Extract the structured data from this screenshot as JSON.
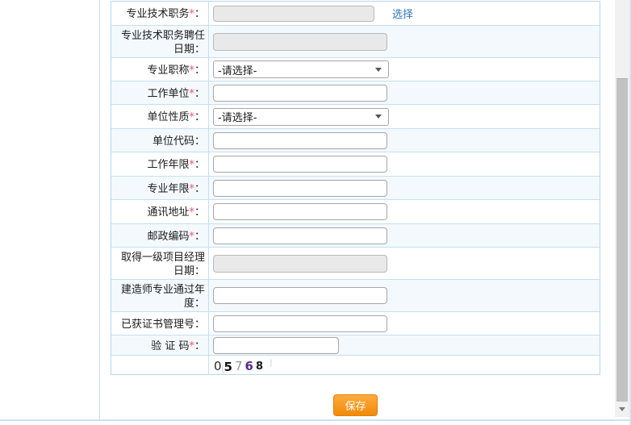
{
  "form": {
    "rows": [
      {
        "label": "专业技术职务",
        "star": "*",
        "colon": "：",
        "type": "readonly",
        "link": "选择"
      },
      {
        "label": "专业技术职务聘任日期",
        "star": "",
        "colon": "：",
        "type": "readonly"
      },
      {
        "label": "专业职称",
        "star": "*",
        "colon": "：",
        "type": "select",
        "value": "-请选择-"
      },
      {
        "label": "工作单位",
        "star": "*",
        "colon": "：",
        "type": "text",
        "value": ""
      },
      {
        "label": "单位性质",
        "star": "*",
        "colon": "：",
        "type": "select",
        "value": "-请选择-"
      },
      {
        "label": "单位代码",
        "star": "",
        "colon": "：",
        "type": "text",
        "value": ""
      },
      {
        "label": "工作年限",
        "star": "*",
        "colon": "：",
        "type": "text",
        "value": ""
      },
      {
        "label": "专业年限",
        "star": "*",
        "colon": "：",
        "type": "text",
        "value": ""
      },
      {
        "label": "通讯地址",
        "star": "*",
        "colon": "：",
        "type": "text",
        "value": ""
      },
      {
        "label": "邮政编码",
        "star": "*",
        "colon": "：",
        "type": "text",
        "value": ""
      },
      {
        "label": "取得一级项目经理日期",
        "star": "",
        "colon": "：",
        "type": "readonly"
      },
      {
        "label": "建造师专业通过年度",
        "star": "",
        "colon": "：",
        "type": "text",
        "value": ""
      },
      {
        "label": "已获证书管理号",
        "star": "",
        "colon": "：",
        "type": "text",
        "value": ""
      },
      {
        "label": "验 证 码",
        "star": "*",
        "colon": "：",
        "type": "text",
        "value": ""
      },
      {
        "label": "",
        "star": "",
        "colon": "",
        "type": "captcha"
      }
    ],
    "save_button": "保存"
  },
  "captcha": {
    "code": "05768",
    "chars": [
      "0",
      "5",
      "7",
      "6",
      "8"
    ]
  },
  "icons": {
    "dropdown_arrow": "triangle-down",
    "scroll_down_arrow": "triangle-down"
  },
  "colors": {
    "link": "#3076bd",
    "save_button_top": "#fdac3e",
    "save_button_bottom": "#f18a0a",
    "table_border": "#b7d7eb",
    "row_tint": "#f4f9fd",
    "required_star": "#ff4d6a",
    "captcha_purple": "#5c2b8a"
  }
}
